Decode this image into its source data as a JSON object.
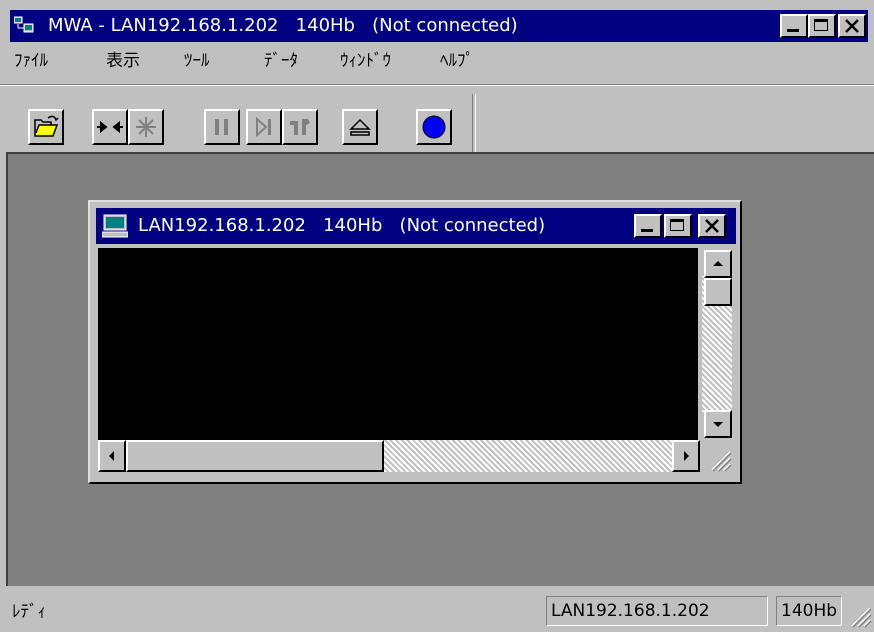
{
  "app": {
    "title": "MWA - LAN192.168.1.202   140Hb   (Not connected)"
  },
  "menu": [
    "ﾌｧｲﾙ",
    "表示",
    "ﾂｰﾙ",
    "ﾃﾞｰﾀ",
    "ｳｨﾝﾄﾞｳ",
    "ﾍﾙﾌﾟ"
  ],
  "toolbar": {
    "icons": [
      "open-folder-icon",
      "connect-icon",
      "disconnect-icon",
      "pause-icon",
      "step-icon",
      "tools-icon",
      "eject-icon",
      "record-icon"
    ]
  },
  "child_window": {
    "title": "LAN192.168.1.202   140Hb   (Not connected)"
  },
  "status": {
    "text": "ﾚﾃﾞｨ",
    "host": "LAN192.168.1.202",
    "model": "140Hb"
  },
  "colors": {
    "title_bar": "#000080",
    "terminal": "#000000",
    "mdi_background": "#808080",
    "record_button": "#0000ff"
  }
}
